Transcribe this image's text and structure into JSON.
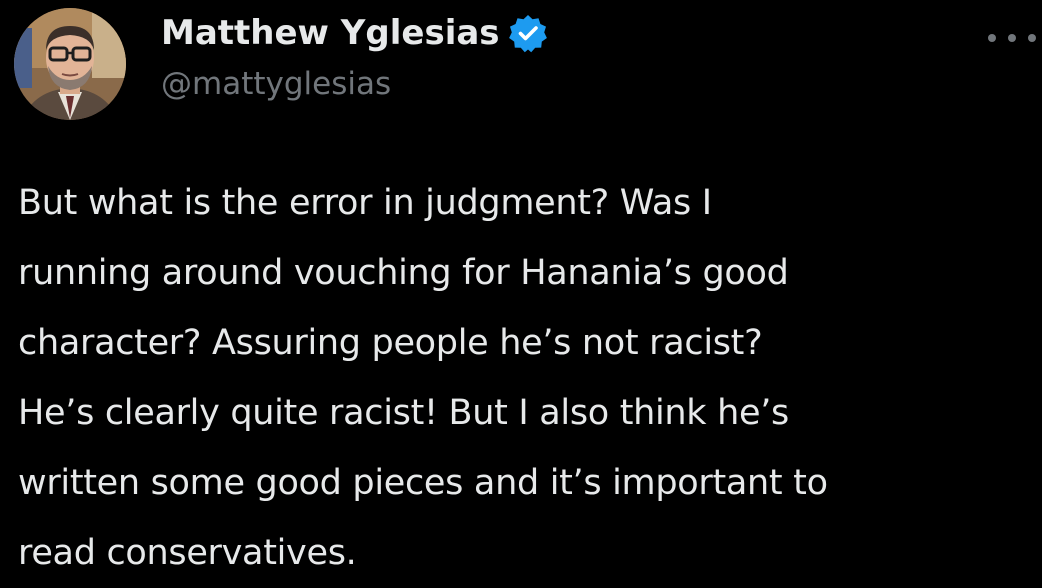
{
  "author": {
    "display_name": "Matthew Yglesias",
    "handle": "@mattyglesias",
    "verified": true
  },
  "colors": {
    "background": "#000000",
    "text": "#e7e9ea",
    "secondary_text": "#71767b",
    "verified_badge": "#1d9bf0"
  },
  "icons": {
    "verified": "verified-badge-icon",
    "more": "more-options-icon"
  },
  "tweet": {
    "lines": [
      "But what is the error in judgment? Was I",
      "running around vouching for Hanania’s good",
      "character? Assuring people he’s not racist?",
      "He’s clearly quite racist! But I also think he’s",
      "written some good pieces and it’s important to",
      "read conservatives."
    ]
  }
}
